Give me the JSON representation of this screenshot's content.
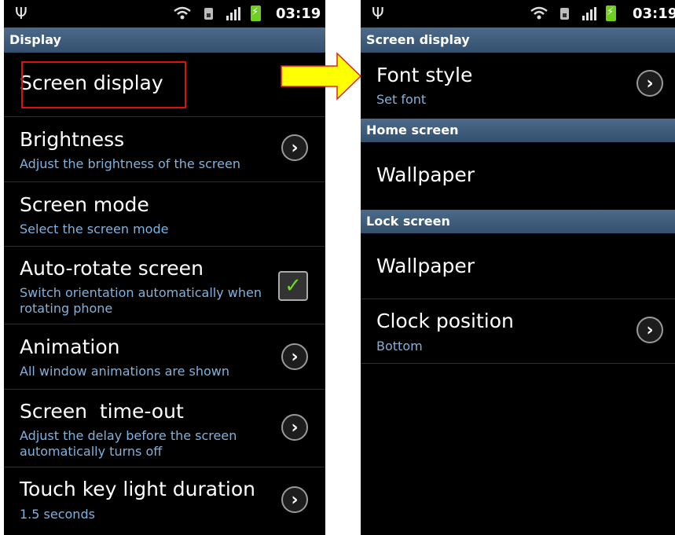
{
  "status_bar": {
    "time": "03:19"
  },
  "left": {
    "title": "Display",
    "items": [
      {
        "title": "Screen display",
        "subtitle": ""
      },
      {
        "title": "Brightness",
        "subtitle": "Adjust the brightness of the screen"
      },
      {
        "title": "Screen mode",
        "subtitle": "Select the screen mode"
      },
      {
        "title": "Auto-rotate screen",
        "subtitle": "Switch orientation automatically when rotating phone",
        "checked": true
      },
      {
        "title": "Animation",
        "subtitle": "All window animations are shown"
      },
      {
        "title": "Screen  time-out",
        "subtitle": "Adjust the delay before the screen automatically turns off"
      },
      {
        "title": "Touch key light duration",
        "subtitle": "1.5 seconds"
      }
    ]
  },
  "right": {
    "title": "Screen display",
    "items": [
      {
        "title": "Font style",
        "subtitle": "Set font"
      }
    ],
    "sections": [
      {
        "header": "Home screen",
        "items": [
          {
            "title": "Wallpaper",
            "subtitle": ""
          }
        ]
      },
      {
        "header": "Lock screen",
        "items": [
          {
            "title": "Wallpaper",
            "subtitle": ""
          },
          {
            "title": "Clock position",
            "subtitle": "Bottom"
          }
        ]
      }
    ]
  },
  "icons": {
    "usb": "usb-icon",
    "wifi": "wifi-icon",
    "sim": "sim-icon",
    "signal": "signal-icon",
    "battery": "battery-charging-icon",
    "chevron": "chevron-right-icon",
    "checkbox": "checkbox-checked-icon",
    "arrow": "arrow-right-icon"
  },
  "colors": {
    "header_bar": "#3e5c7c",
    "subtitle": "#7fb2de",
    "highlight_box": "#e01010",
    "arrow_fill": "#ffff00",
    "arrow_stroke": "#e02020",
    "checkmark": "#6ddc1e",
    "battery": "#6fcf1f"
  }
}
